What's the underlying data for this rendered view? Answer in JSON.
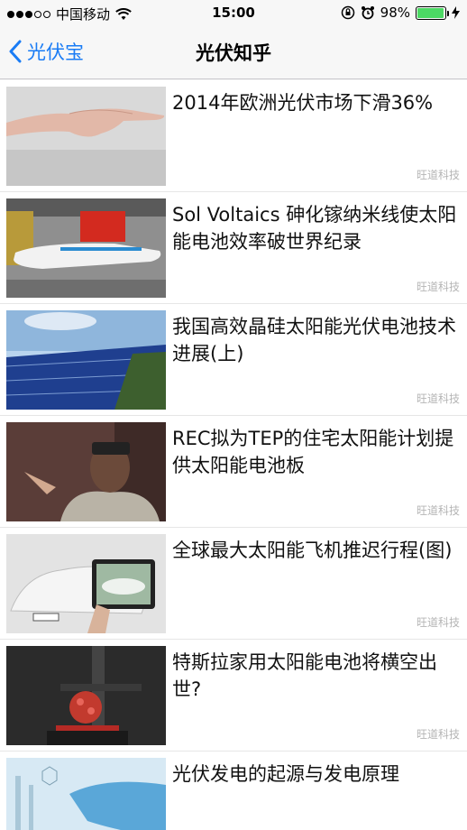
{
  "status": {
    "carrier": "中国移动",
    "time": "15:00",
    "battery": "98%",
    "battery_level": 0.98
  },
  "nav": {
    "back_label": "光伏宝",
    "title": "光伏知乎"
  },
  "articles": [
    {
      "title": "2014年欧洲光伏市场下滑36%",
      "source": "旺道科技"
    },
    {
      "title": "Sol Voltaics 砷化镓纳米线使太阳能电池效率破世界纪录",
      "source": "旺道科技"
    },
    {
      "title": "我国高效晶硅太阳能光伏电池技术进展(上)",
      "source": "旺道科技"
    },
    {
      "title": "REC拟为TEP的住宅太阳能计划提供太阳能电池板",
      "source": "旺道科技"
    },
    {
      "title": "全球最大太阳能飞机推迟行程(图)",
      "source": "旺道科技"
    },
    {
      "title": "特斯拉家用太阳能电池将横空出世?",
      "source": "旺道科技"
    },
    {
      "title": "光伏发电的起源与发电原理",
      "source": ""
    }
  ],
  "colors": {
    "accent": "#1a7cf5",
    "battery": "#4cd964"
  }
}
